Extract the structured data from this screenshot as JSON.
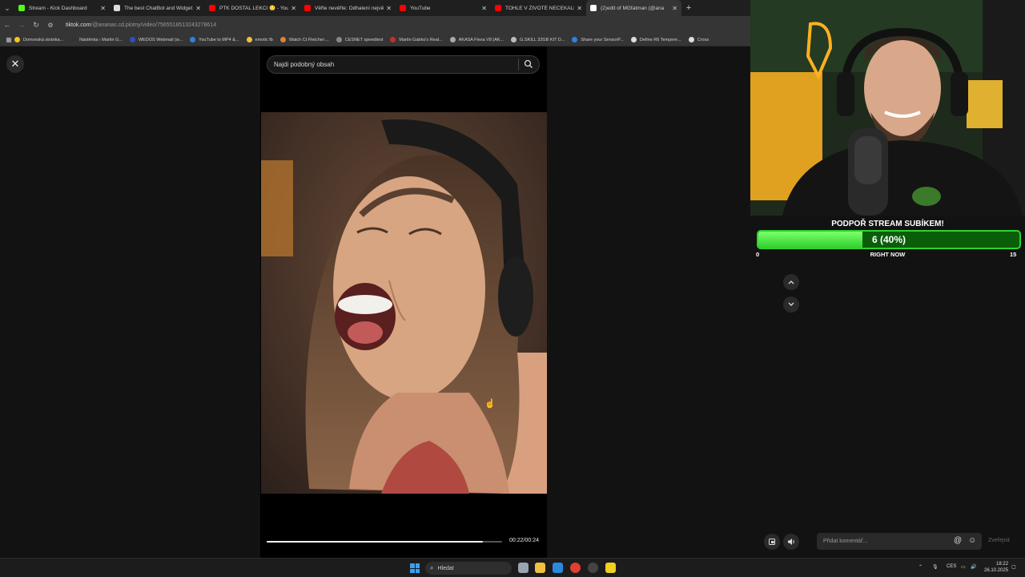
{
  "browser": {
    "tabs": [
      {
        "title": "Stream - Kick Dashboard",
        "color": "#53fc18",
        "active": false
      },
      {
        "title": "The best ChatBot and Widget",
        "color": "#dddddd",
        "active": false
      },
      {
        "title": "PTK DOSTAL LEKCI 😳 - YouTu",
        "color": "#ff0000",
        "active": false
      },
      {
        "title": "Věřte nevěřte: Odhalení největš",
        "color": "#ff0000",
        "active": false
      },
      {
        "title": "YouTube",
        "color": "#ff0000",
        "active": false
      },
      {
        "title": "TOHLE V ŽIVOTĚ NEČEKALI - Y",
        "color": "#ff0000",
        "active": false
      },
      {
        "title": "(2)edit of MGfatman (@ana",
        "color": "#ffffff",
        "active": true
      }
    ],
    "url_host": "tiktok.com",
    "url_path": "/@ananas.cd.plotny/video/7565518513243278614",
    "bookmarks": [
      {
        "label": "Domovská stránka...",
        "color": "#f5c518"
      },
      {
        "label": "Nástěnka ‹ Martin G...",
        "color": "#333333"
      },
      {
        "label": "WEDOS Webmail (w...",
        "color": "#3050c0"
      },
      {
        "label": "YouTube to MP4 &...",
        "color": "#3080e0"
      },
      {
        "label": "emotic fb",
        "color": "#f0c040"
      },
      {
        "label": "Watch Ct Fletcher:...",
        "color": "#e08030"
      },
      {
        "label": "CESNET speedtest",
        "color": "#888888"
      },
      {
        "label": "Martin Gabko's Real...",
        "color": "#c03030"
      },
      {
        "label": "AKASA Flexa V8 (AK...",
        "color": "#aaaaaa"
      },
      {
        "label": "G.SKILL 32GB KIT D...",
        "color": "#bbbbbb"
      },
      {
        "label": "Share your SensorP...",
        "color": "#3080e0"
      },
      {
        "label": "Define R6 Tempere...",
        "color": "#dddddd"
      },
      {
        "label": "Cross",
        "color": "#dddddd"
      }
    ]
  },
  "tiktok": {
    "search_placeholder": "Najdi podobný obsah",
    "time": "00:22/00:24",
    "progress_fraction": 0.917
  },
  "overlay": {
    "sub_goal_title": "PODPOŘ STREAM SUBÍKEM!",
    "sub_goal_text": "6 (40%)",
    "sub_goal_fraction": 0.4,
    "sub_min": "0",
    "sub_label": "RIGHT NOW",
    "sub_max": "15",
    "comment_placeholder": "Přidat komentář...",
    "comment_send": "Zveřejnit"
  },
  "taskbar": {
    "search_label": "Hledat",
    "language": "CES",
    "time": "18:22",
    "date": "26.10.2025"
  }
}
